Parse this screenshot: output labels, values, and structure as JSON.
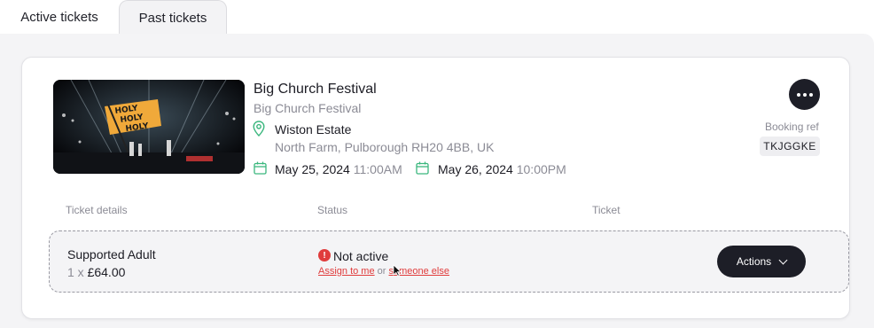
{
  "tabs": [
    {
      "label": "Active tickets",
      "active": true
    },
    {
      "label": "Past tickets",
      "active": false
    }
  ],
  "event": {
    "title": "Big Church Festival",
    "subtitle": "Big Church Festival",
    "image_icon": "festival-stage-image",
    "image_flag_text": "HOLY HOLY HOLY",
    "venue_name": "Wiston Estate",
    "venue_address": "North Farm, Pulborough RH20 4BB, UK",
    "start_date": "May 25, 2024",
    "start_time": "11:00AM",
    "end_date": "May 26, 2024",
    "end_time": "10:00PM"
  },
  "booking": {
    "label": "Booking ref",
    "ref": "TKJGGKE"
  },
  "columns": {
    "details": "Ticket details",
    "status": "Status",
    "ticket": "Ticket"
  },
  "ticket": {
    "name": "Supported Adult",
    "qty_prefix": "1 x",
    "price": "£64.00",
    "status": "Not active",
    "assign_me": "Assign to me",
    "or_text": "or",
    "assign_else": "someone else",
    "actions_label": "Actions"
  },
  "colors": {
    "accent_dark": "#1d1e27",
    "status_red": "#e03c3c",
    "icon_green": "#3bb77e",
    "panel_bg": "#f4f4f6"
  }
}
